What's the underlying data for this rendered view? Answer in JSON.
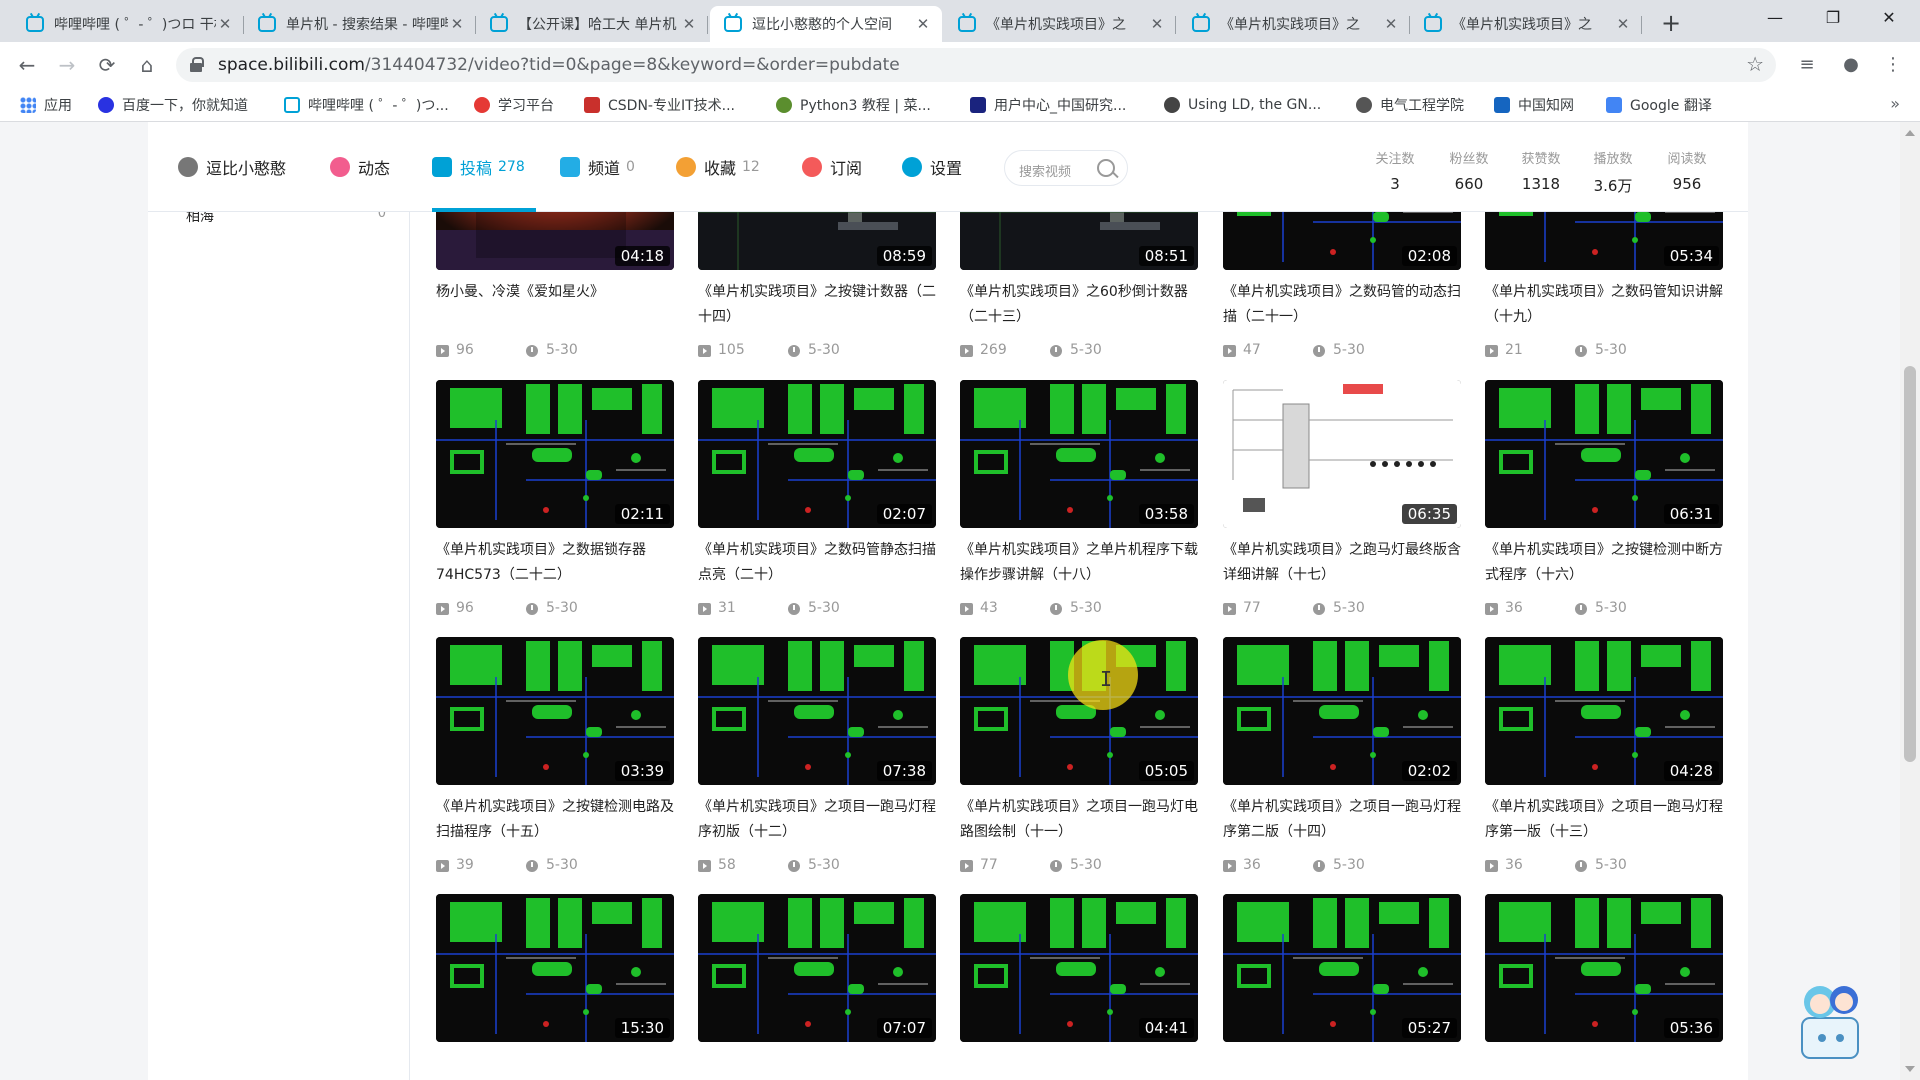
{
  "browser": {
    "tabs": [
      {
        "title": "哔哩哔哩 ( ゜- ゜)つロ 干杯",
        "active": false
      },
      {
        "title": "单片机 - 搜索结果 - 哔哩哔哩",
        "active": false
      },
      {
        "title": "【公开课】哈工大 单片机",
        "active": false
      },
      {
        "title": "逗比小憨憨的个人空间",
        "active": true
      },
      {
        "title": "《单片机实践项目》之",
        "active": false
      },
      {
        "title": "《单片机实践项目》之",
        "active": false
      },
      {
        "title": "《单片机实践项目》之",
        "active": false
      }
    ],
    "url_host": "space.bilibili.com",
    "url_path": "/314404732/video?tid=0&page=8&keyword=&order=pubdate",
    "bookmarks": [
      {
        "label": "应用",
        "color": "#4285f4"
      },
      {
        "label": "百度一下，你就知道",
        "color": "#2932e1"
      },
      {
        "label": "哔哩哔哩 ( ゜- ゜)つ...",
        "color": "#00a1d6"
      },
      {
        "label": "学习平台",
        "color": "#e53935"
      },
      {
        "label": "CSDN-专业IT技术...",
        "color": "#c9302c"
      },
      {
        "label": "Python3 教程 | 菜...",
        "color": "#5b8e2e"
      },
      {
        "label": "用户中心_中国研究...",
        "color": "#1a237e"
      },
      {
        "label": "Using LD, the GN...",
        "color": "#444444"
      },
      {
        "label": "电气工程学院",
        "color": "#555555"
      },
      {
        "label": "中国知网",
        "color": "#1565c0"
      },
      {
        "label": "Google 翻译",
        "color": "#4285f4"
      }
    ]
  },
  "space": {
    "nav": [
      {
        "label": "逗比小憨憨",
        "count": "",
        "color": "#777777"
      },
      {
        "label": "动态",
        "count": "",
        "color": "#f25d8e"
      },
      {
        "label": "投稿",
        "count": "278",
        "color": "#00a1d6"
      },
      {
        "label": "频道",
        "count": "0",
        "color": "#23ade5"
      },
      {
        "label": "收藏",
        "count": "12",
        "color": "#f3a034"
      },
      {
        "label": "订阅",
        "count": "",
        "color": "#f45a5a"
      },
      {
        "label": "设置",
        "count": "",
        "color": "#00a1d6"
      }
    ],
    "search_placeholder": "搜索视频",
    "stats": [
      {
        "label": "关注数",
        "value": "3"
      },
      {
        "label": "粉丝数",
        "value": "660"
      },
      {
        "label": "获赞数",
        "value": "1318"
      },
      {
        "label": "播放数",
        "value": "3.6万"
      },
      {
        "label": "阅读数",
        "value": "956"
      }
    ],
    "sidebar_item": {
      "label": "相海",
      "count": "0"
    }
  },
  "videos": [
    {
      "title": "杨小曼、冷漠《爱如星火》",
      "duration": "04:18",
      "plays": "96",
      "date": "5-30",
      "thumb": "fireworks"
    },
    {
      "title": "《单片机实践项目》之按键计数器（二十四）",
      "duration": "08:59",
      "plays": "105",
      "date": "5-30",
      "thumb": "dark"
    },
    {
      "title": "《单片机实践项目》之60秒倒计数器（二十三）",
      "duration": "08:51",
      "plays": "269",
      "date": "5-30",
      "thumb": "dark"
    },
    {
      "title": "《单片机实践项目》之数码管的动态扫描（二十一）",
      "duration": "02:08",
      "plays": "47",
      "date": "5-30",
      "thumb": "green"
    },
    {
      "title": "《单片机实践项目》之数码管知识讲解（十九）",
      "duration": "05:34",
      "plays": "21",
      "date": "5-30",
      "thumb": "green"
    },
    {
      "title": "《单片机实践项目》之数据锁存器74HC573（二十二）",
      "duration": "02:11",
      "plays": "96",
      "date": "5-30",
      "thumb": "green"
    },
    {
      "title": "《单片机实践项目》之数码管静态扫描点亮（二十）",
      "duration": "02:07",
      "plays": "31",
      "date": "5-30",
      "thumb": "green"
    },
    {
      "title": "《单片机实践项目》之单片机程序下载操作步骤讲解（十八）",
      "duration": "03:58",
      "plays": "43",
      "date": "5-30",
      "thumb": "green"
    },
    {
      "title": "《单片机实践项目》之跑马灯最终版含详细讲解（十七）",
      "duration": "06:35",
      "plays": "77",
      "date": "5-30",
      "thumb": "white"
    },
    {
      "title": "《单片机实践项目》之按键检测中断方式程序（十六）",
      "duration": "06:31",
      "plays": "36",
      "date": "5-30",
      "thumb": "green"
    },
    {
      "title": "《单片机实践项目》之按键检测电路及扫描程序（十五）",
      "duration": "03:39",
      "plays": "39",
      "date": "5-30",
      "thumb": "green"
    },
    {
      "title": "《单片机实践项目》之项目一跑马灯程序初版（十二）",
      "duration": "07:38",
      "plays": "58",
      "date": "5-30",
      "thumb": "green"
    },
    {
      "title": "《单片机实践项目》之项目一跑马灯电路图绘制（十一）",
      "duration": "05:05",
      "plays": "77",
      "date": "5-30",
      "thumb": "green"
    },
    {
      "title": "《单片机实践项目》之项目一跑马灯程序第二版（十四）",
      "duration": "02:02",
      "plays": "36",
      "date": "5-30",
      "thumb": "green"
    },
    {
      "title": "《单片机实践项目》之项目一跑马灯程序第一版（十三）",
      "duration": "04:28",
      "plays": "36",
      "date": "5-30",
      "thumb": "green"
    },
    {
      "title": "",
      "duration": "15:30",
      "plays": "",
      "date": "",
      "thumb": "green"
    },
    {
      "title": "",
      "duration": "07:07",
      "plays": "",
      "date": "",
      "thumb": "green"
    },
    {
      "title": "",
      "duration": "04:41",
      "plays": "",
      "date": "",
      "thumb": "green"
    },
    {
      "title": "",
      "duration": "05:27",
      "plays": "",
      "date": "",
      "thumb": "green"
    },
    {
      "title": "",
      "duration": "05:36",
      "plays": "",
      "date": "",
      "thumb": "green"
    }
  ]
}
